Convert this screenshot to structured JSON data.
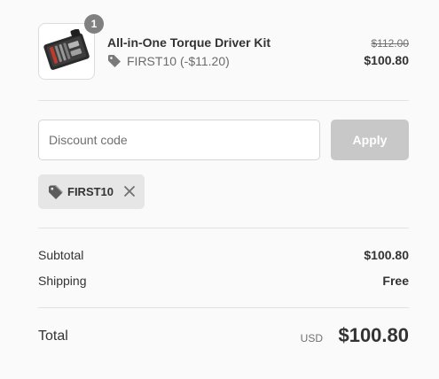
{
  "product": {
    "name": "All-in-One Torque Driver Kit",
    "quantity": "1",
    "discount_code": "FIRST10",
    "discount_amount": "(-$11.20)",
    "original_price": "$112.00",
    "price": "$100.80",
    "image_icon": "torque-driver-kit-case"
  },
  "discount_form": {
    "placeholder": "Discount code",
    "apply_label": "Apply"
  },
  "applied_discount": {
    "code": "FIRST10"
  },
  "summary": {
    "subtotal_label": "Subtotal",
    "subtotal_value": "$100.80",
    "shipping_label": "Shipping",
    "shipping_value": "Free"
  },
  "total": {
    "label": "Total",
    "currency": "USD",
    "value": "$100.80"
  },
  "colors": {
    "background": "#fafafa",
    "text": "#333333",
    "muted": "#707070",
    "apply_disabled": "#c8c8c8",
    "tag_background": "#e6e6e6"
  }
}
